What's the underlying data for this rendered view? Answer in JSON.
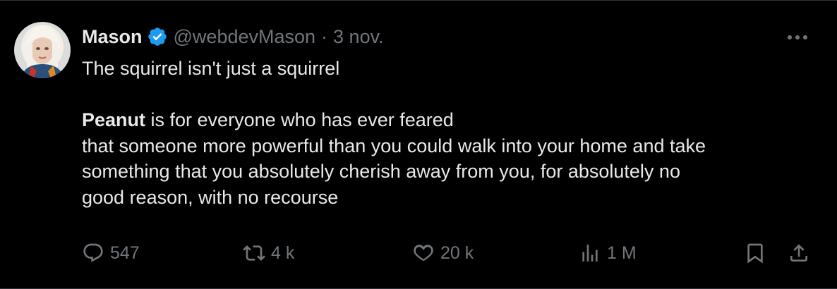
{
  "tweet": {
    "author": {
      "name": "Mason",
      "handle": "@webdevMason",
      "verified": true,
      "avatar": "avatar-photo"
    },
    "separator": "·",
    "date": "3 nov.",
    "text": {
      "line1": "The squirrel isn't just a squirrel",
      "bold_word": "Peanut",
      "rest_first": " is for everyone who has ever feared",
      "line3": "that someone more powerful than you could walk into your home and take",
      "line4": "something that you absolutely cherish away from you, for absolutely no",
      "line5": "good reason, with no recourse"
    },
    "actions": {
      "replies": "547",
      "reposts": "4 k",
      "likes": "20 k",
      "views": "1 M"
    }
  },
  "colors": {
    "background": "#000000",
    "text": "#e7e9ea",
    "muted": "#71767b",
    "verified": "#1d9bf0",
    "border": "#2f3336"
  },
  "icons": [
    "more-icon",
    "verified-badge-icon",
    "reply-icon",
    "repost-icon",
    "like-icon",
    "views-icon",
    "bookmark-icon",
    "share-icon"
  ]
}
